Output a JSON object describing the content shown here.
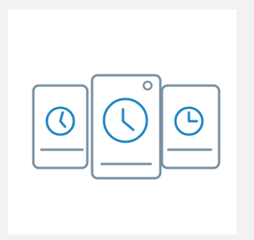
{
  "illustration": {
    "icon_name": "multiple-time-zones-cards-icon",
    "colors": {
      "page_background": "#f2f2f2",
      "card_background": "#ffffff",
      "card_stroke": "#7891a3",
      "clock_stroke": "#1f86c4"
    },
    "cards": [
      {
        "name": "left-card",
        "clock_icon": "clock-icon"
      },
      {
        "name": "center-card",
        "clock_icon": "clock-icon"
      },
      {
        "name": "right-card",
        "clock_icon": "clock-icon"
      }
    ]
  }
}
